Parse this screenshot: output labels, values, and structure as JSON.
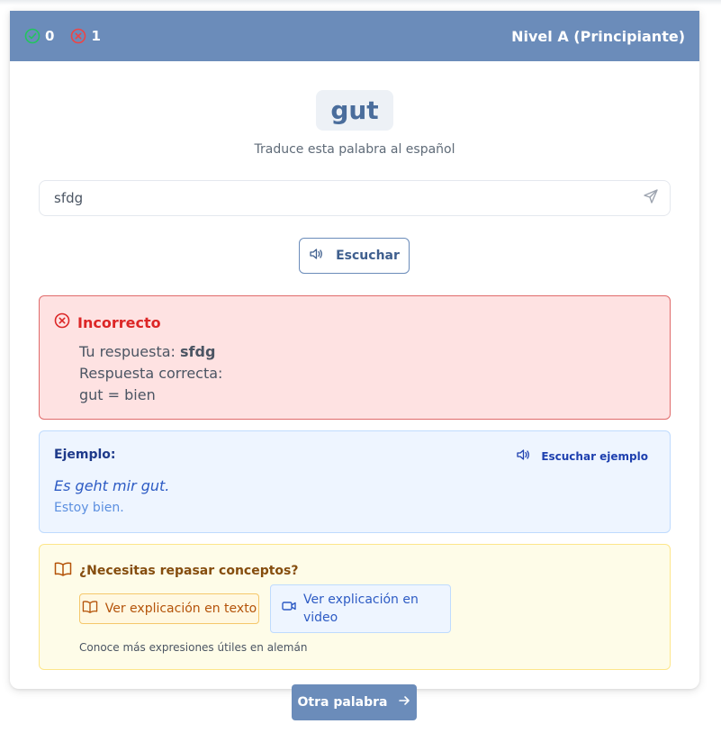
{
  "header": {
    "correct_count": "0",
    "incorrect_count": "1",
    "level": "Nivel A (Principiante)"
  },
  "word": {
    "value": "gut",
    "instruction": "Traduce esta palabra al español"
  },
  "answer_input": {
    "value": "sfdg"
  },
  "listen_button": {
    "label": "Escuchar"
  },
  "feedback": {
    "title": "Incorrecto",
    "your_answer_label": "Tu respuesta:",
    "your_answer_value": "sfdg",
    "correct_answer_label": "Respuesta correcta:",
    "correct_answer_value": "gut = bien"
  },
  "example": {
    "label": "Ejemplo:",
    "listen_label": "Escuchar ejemplo",
    "sentence": "Es geht mir gut.",
    "translation": "Estoy bien."
  },
  "review": {
    "title": "¿Necesitas repasar conceptos?",
    "text_button": "Ver explicación en texto",
    "video_button": "Ver explicación en video",
    "note": "Conoce más expresiones útiles en alemán"
  },
  "next_button": {
    "label": "Otra palabra"
  },
  "colors": {
    "header": "#6b8cba",
    "correct": "#22c55e",
    "incorrect": "#ef4444",
    "error_bg": "#fee2e2",
    "example_bg": "#eef5ff",
    "review_bg": "#fefce8"
  }
}
